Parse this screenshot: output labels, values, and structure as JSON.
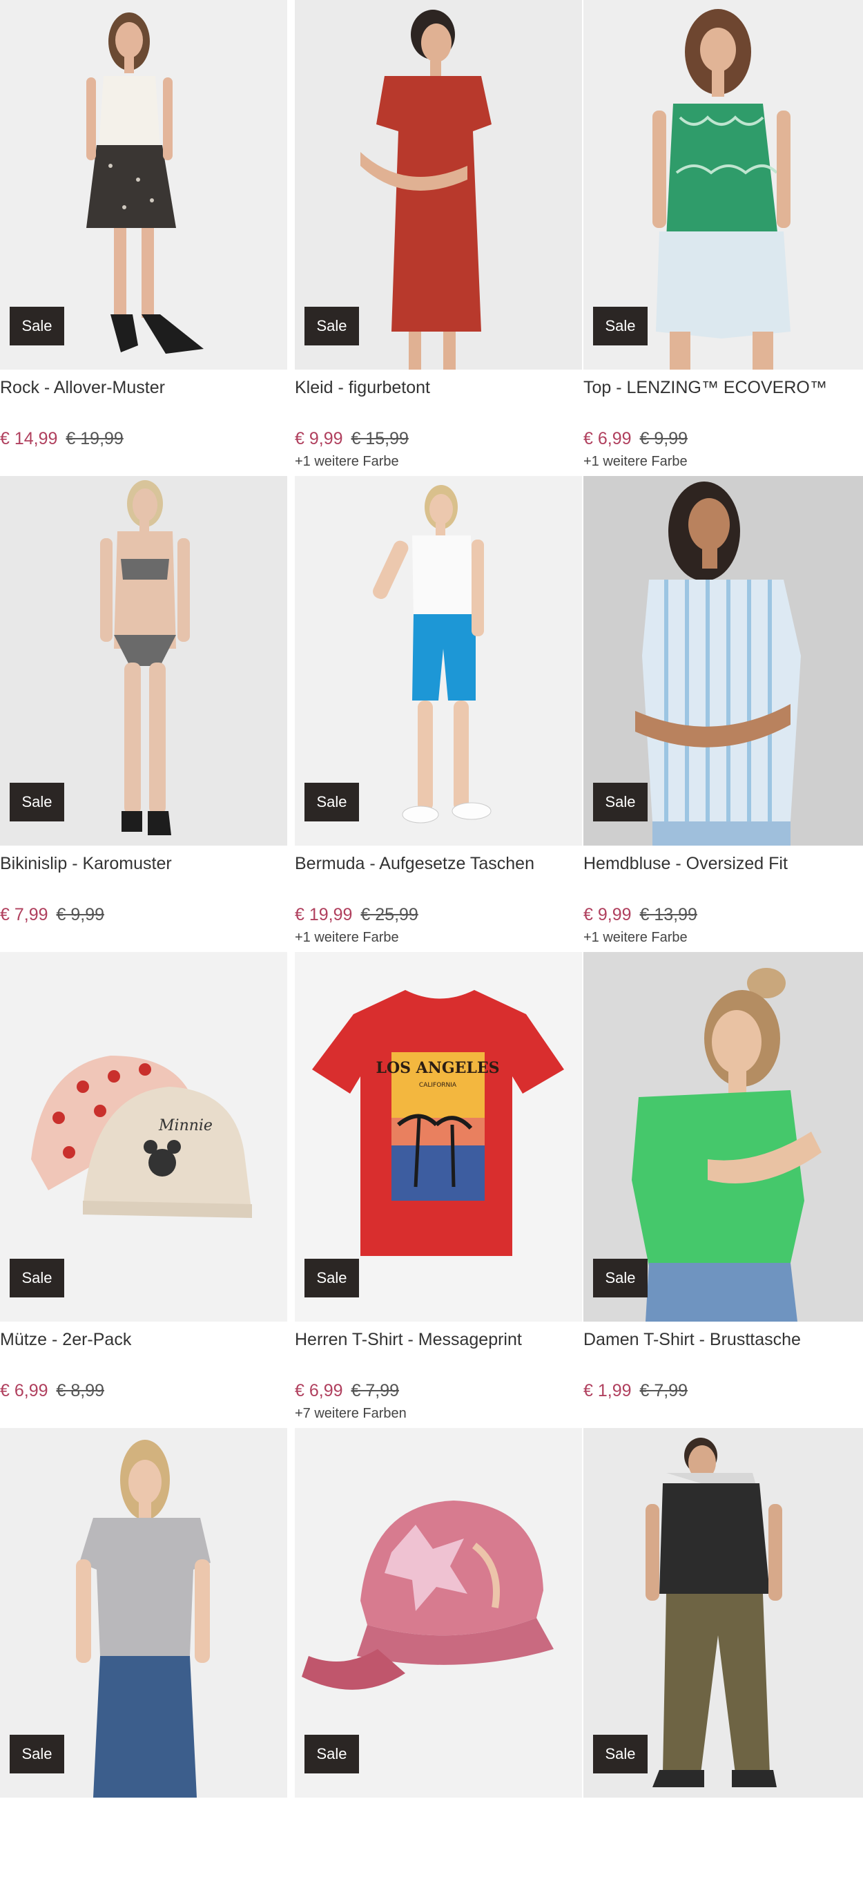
{
  "sale_label": "Sale",
  "colors": {
    "price_sale": "#b0405e",
    "badge_bg": "#2b2624"
  },
  "products": [
    {
      "title": "Rock - Allover-Muster",
      "price": "€ 14,99",
      "old_price": "€ 19,99",
      "colors_note": "",
      "image": "woman-white-top-patterned-skirt"
    },
    {
      "title": "Kleid - figurbetont",
      "price": "€ 9,99",
      "old_price": "€ 15,99",
      "colors_note": "+1 weitere Farbe",
      "image": "woman-red-dress"
    },
    {
      "title": "Top - LENZING™ ECOVERO™",
      "price": "€ 6,99",
      "old_price": "€ 9,99",
      "colors_note": "+1 weitere Farbe",
      "image": "woman-green-top-denim-shorts"
    },
    {
      "title": "Bikinislip - Karomuster",
      "price": "€ 7,99",
      "old_price": "€ 9,99",
      "colors_note": "",
      "image": "woman-checkered-bikini"
    },
    {
      "title": "Bermuda - Aufgesetze Taschen",
      "price": "€ 19,99",
      "old_price": "€ 25,99",
      "colors_note": "+1 weitere Farbe",
      "image": "woman-blue-bermuda-shorts"
    },
    {
      "title": "Hemdbluse - Oversized Fit",
      "price": "€ 9,99",
      "old_price": "€ 13,99",
      "colors_note": "+1 weitere Farbe",
      "image": "woman-striped-blouse"
    },
    {
      "title": "Mütze - 2er-Pack",
      "price": "€ 6,99",
      "old_price": "€ 8,99",
      "colors_note": "",
      "image": "two-baby-beanies"
    },
    {
      "title": "Herren T-Shirt - Messageprint",
      "price": "€ 6,99",
      "old_price": "€ 7,99",
      "colors_note": "+7 weitere Farben",
      "image": "red-tshirt-los-angeles"
    },
    {
      "title": "Damen T-Shirt - Brusttasche",
      "price": "€ 1,99",
      "old_price": "€ 7,99",
      "colors_note": "",
      "image": "woman-green-tshirt"
    },
    {
      "title": "",
      "price": "",
      "old_price": "",
      "colors_note": "",
      "image": "woman-grey-tshirt-jeans"
    },
    {
      "title": "",
      "price": "",
      "old_price": "",
      "colors_note": "",
      "image": "pink-metallic-cap"
    },
    {
      "title": "",
      "price": "",
      "old_price": "",
      "colors_note": "",
      "image": "man-hooded-shirt-khaki-pants"
    }
  ],
  "print_texts": {
    "tshirt_line1": "LOS ANGELES",
    "tshirt_line2": "CALIFORNIA",
    "beanie_text": "Minnie"
  }
}
